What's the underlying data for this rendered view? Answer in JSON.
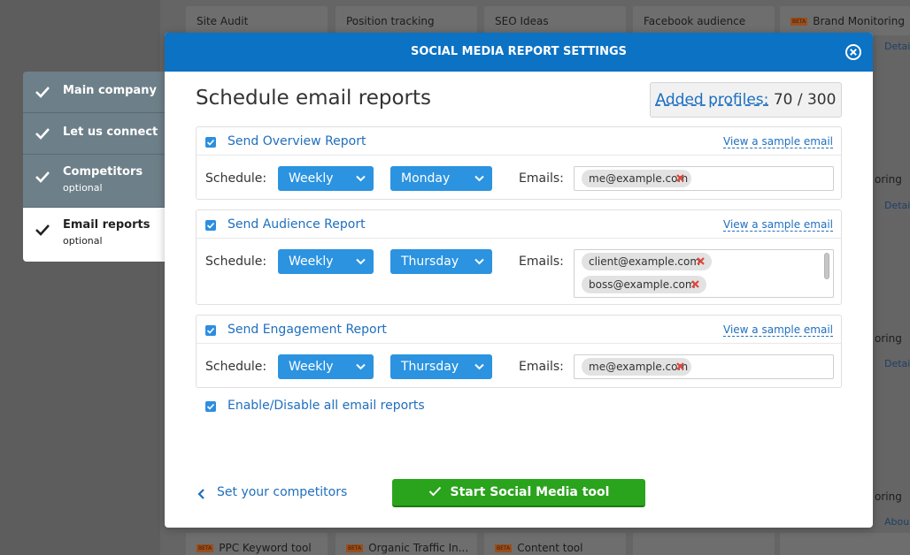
{
  "background": {
    "tiles_top": [
      "Site Audit",
      "Position tracking",
      "SEO Ideas",
      "Facebook audience",
      "Brand Monitoring"
    ],
    "tiles_bottom": [
      "PPC Keyword tool",
      "Organic Traffic In...",
      "Content tool"
    ],
    "beta_badge": "BETA",
    "side_text": [
      "oring",
      "oring",
      "oring"
    ],
    "side_links": [
      "Detail",
      "Detail",
      "Detail",
      "Detail",
      "Abou"
    ]
  },
  "steps": [
    {
      "label": "Main company",
      "sub": ""
    },
    {
      "label": "Let us connect",
      "sub": ""
    },
    {
      "label": "Competitors",
      "sub": "optional"
    },
    {
      "label": "Email reports",
      "sub": "optional"
    }
  ],
  "modal": {
    "title": "SOCIAL MEDIA REPORT SETTINGS",
    "heading": "Schedule email reports",
    "profiles_link": "Added profiles:",
    "profiles_count": "70 / 300"
  },
  "reports": [
    {
      "title": "Send Overview Report",
      "sample": "View a sample email",
      "schedule_label": "Schedule:",
      "frequency": "Weekly",
      "day": "Monday",
      "emails_label": "Emails:",
      "emails": [
        "me@example.com"
      ]
    },
    {
      "title": "Send Audience Report",
      "sample": "View a sample email",
      "schedule_label": "Schedule:",
      "frequency": "Weekly",
      "day": "Thursday",
      "emails_label": "Emails:",
      "emails": [
        "client@example.com",
        "boss@example.com"
      ]
    },
    {
      "title": "Send Engagement Report",
      "sample": "View a sample email",
      "schedule_label": "Schedule:",
      "frequency": "Weekly",
      "day": "Thursday",
      "emails_label": "Emails:",
      "emails": [
        "me@example.com"
      ]
    }
  ],
  "toggle_all": "Enable/Disable all email reports",
  "footer": {
    "back": "Set your competitors",
    "start": "Start Social Media tool"
  },
  "colors": {
    "header": "#0b72c4",
    "accent": "#2b93e0",
    "start": "#2aa31d",
    "remove": "#e0453a"
  }
}
